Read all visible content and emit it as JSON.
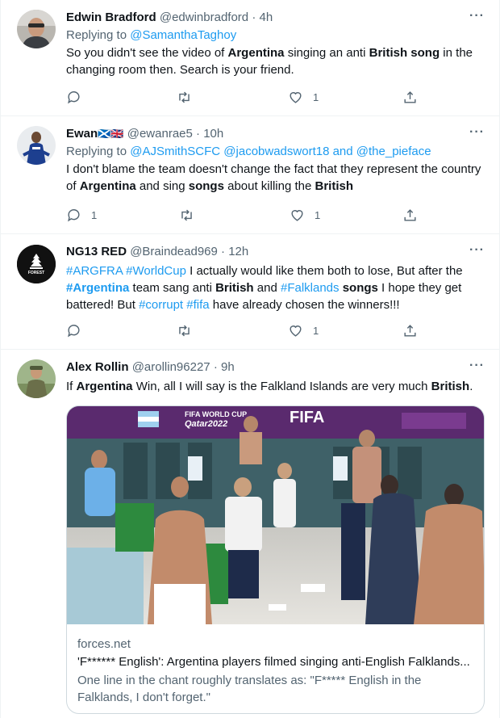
{
  "tweets": [
    {
      "name": "Edwin Bradford",
      "handle": "@edwinbradford",
      "time": "4h",
      "reply_prefix": "Replying to",
      "reply_to": "@SamanthaTaghoy",
      "text": [
        "So you didn't see the video of ",
        "Argentina",
        " singing an anti ",
        "British",
        " ",
        "song",
        " in the changing room then. Search is your friend."
      ],
      "replies": "",
      "retweets": "",
      "likes": "1"
    },
    {
      "name": "Ewan",
      "flags": "🏴󠁧󠁢󠁳󠁣󠁴󠁿🇬🇧",
      "handle": "@ewanrae5",
      "time": "10h",
      "reply_prefix": "Replying to",
      "reply_to": "@AJSmithSCFC @jacobwadswort18 and @the_pieface",
      "text": [
        "I don't blame the team doesn't change the fact that they represent the country of ",
        "Argentina",
        " and sing ",
        "songs",
        " about killing the ",
        "British"
      ],
      "replies": "1",
      "retweets": "",
      "likes": "1"
    },
    {
      "name": "NG13 RED",
      "handle": "@Braindead969",
      "time": "12h",
      "avatar_text": "FOREST",
      "text_parts": [
        {
          "t": "#ARGFRA #WorldCup",
          "s": "blue"
        },
        {
          "t": " I actually would like them both to lose, But after the ",
          "s": ""
        },
        {
          "t": "#Argentina",
          "s": "blue"
        },
        {
          "t": " team  sang anti ",
          "s": ""
        },
        {
          "t": "British",
          "s": "bold"
        },
        {
          "t": " and ",
          "s": ""
        },
        {
          "t": "#Falklands",
          "s": "blue"
        },
        {
          "t": " ",
          "s": ""
        },
        {
          "t": "songs",
          "s": "bold"
        },
        {
          "t": " I hope they get battered! But ",
          "s": ""
        },
        {
          "t": "#corrupt #fifa",
          "s": "blue"
        },
        {
          "t": " have already chosen the winners!!!",
          "s": ""
        }
      ],
      "replies": "",
      "retweets": "",
      "likes": "1"
    },
    {
      "name": "Alex Rollin",
      "handle": "@arollin96227",
      "time": "9h",
      "text": [
        "If ",
        "Argentina",
        " Win, all I will say is the Falkland Islands are very much ",
        "British",
        "."
      ]
    }
  ],
  "card": {
    "image_banner_left": "FIFA WORLD CUP",
    "image_banner_sub": "Qatar2022",
    "image_banner_right": "FIFA",
    "domain": "forces.net",
    "title": "'F****** English': Argentina players filmed singing anti-English Falklands...",
    "description": "One line in the chant roughly translates as: \"F***** English in the Falklands, I don't forget.\""
  },
  "separator": "·",
  "more": "···"
}
